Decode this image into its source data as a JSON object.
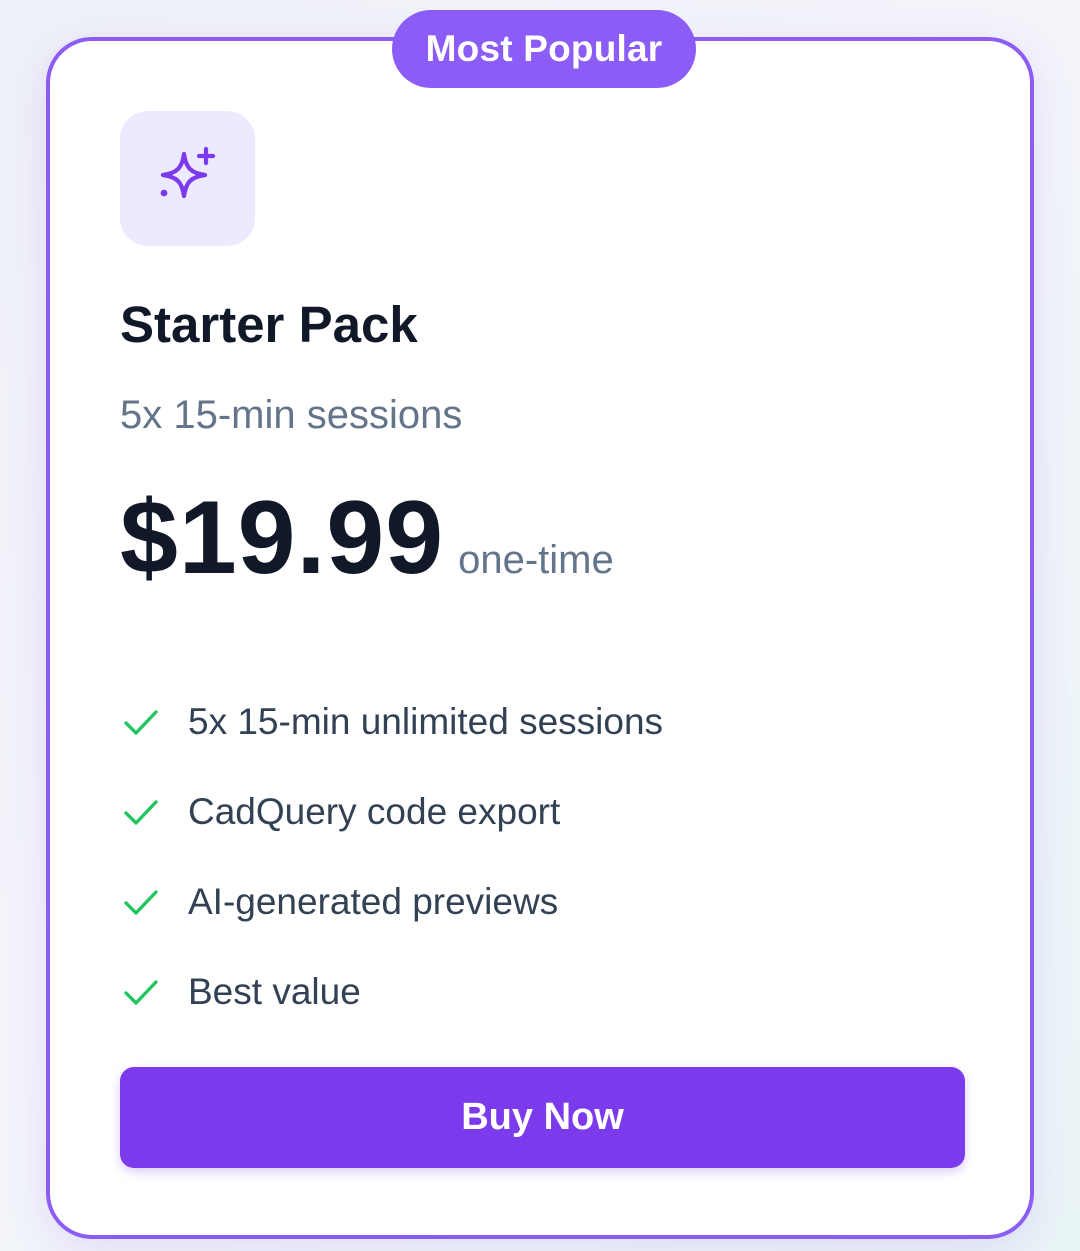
{
  "plan": {
    "badge": "Most Popular",
    "icon": "sparkles-icon",
    "title": "Starter Pack",
    "subtitle": "5x 15-min sessions",
    "price": "$19.99",
    "price_period": "one-time",
    "features": [
      {
        "label": "5x 15-min unlimited sessions",
        "icon": "check-icon"
      },
      {
        "label": "CadQuery code export",
        "icon": "check-icon"
      },
      {
        "label": "AI-generated previews",
        "icon": "check-icon"
      },
      {
        "label": "Best value",
        "icon": "check-icon"
      }
    ],
    "cta_label": "Buy Now"
  },
  "colors": {
    "accent": "#7c3aed",
    "badge": "#8b5cf6",
    "icon_tile": "#ede9fe",
    "check": "#22c55e",
    "title": "#111827",
    "muted": "#64748b"
  }
}
